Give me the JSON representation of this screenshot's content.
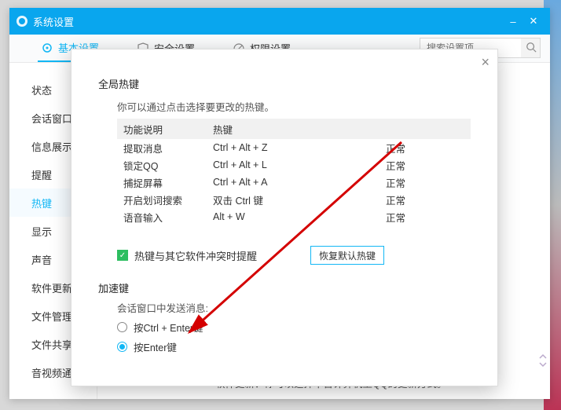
{
  "window": {
    "title": "系统设置",
    "minimize": "–",
    "close": "✕"
  },
  "tabs": {
    "basic": "基本设置",
    "security": "安全设置",
    "perm": "权限设置"
  },
  "search": {
    "placeholder": "搜索设置项"
  },
  "sidebar": {
    "items": [
      "状态",
      "会话窗口",
      "信息展示",
      "提醒",
      "热键",
      "显示",
      "声音",
      "软件更新",
      "文件管理",
      "文件共享",
      "音视频通话"
    ],
    "activeIndex": 4
  },
  "hk": {
    "section": "全局热键",
    "desc": "你可以通过点击选择要更改的热键。",
    "cols": {
      "name": "功能说明",
      "key": "热键",
      "status": ""
    },
    "rows": [
      {
        "name": "提取消息",
        "key": "Ctrl + Alt + Z",
        "status": "正常"
      },
      {
        "name": "锁定QQ",
        "key": "Ctrl + Alt + L",
        "status": "正常"
      },
      {
        "name": "捕捉屏幕",
        "key": "Ctrl + Alt + A",
        "status": "正常"
      },
      {
        "name": "开启划词搜索",
        "key": "双击 Ctrl 键",
        "status": "正常"
      },
      {
        "name": "语音输入",
        "key": "Alt + W",
        "status": "正常"
      }
    ],
    "conflict": "热键与其它软件冲突时提醒",
    "restore": "恢复默认热键"
  },
  "accel": {
    "section": "加速键",
    "sendTitle": "会话窗口中发送消息:",
    "opt1": "按Ctrl + Enter键",
    "opt2": "按Enter键",
    "selected": 1
  },
  "footer": {
    "text": "软件更新：你可以选择本台计算机上QQ的更新方式。"
  }
}
